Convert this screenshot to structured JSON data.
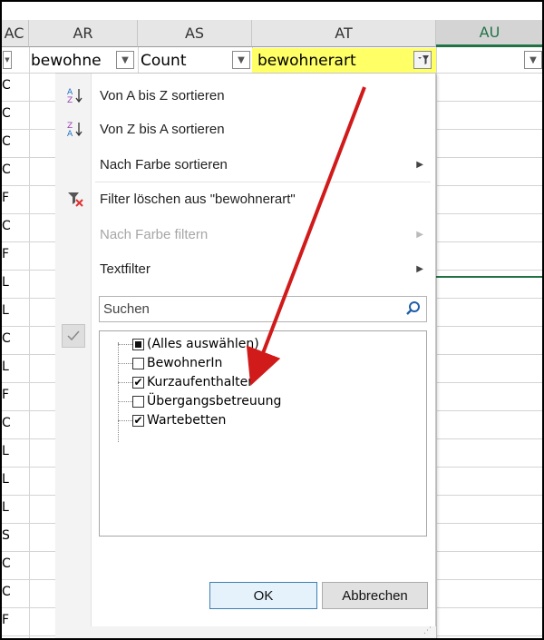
{
  "columns": {
    "ac": "AC",
    "ar": "AR",
    "as": "AS",
    "at": "AT",
    "au": "AU"
  },
  "header_row": {
    "ar_value": "bewohne",
    "as_value": "Count",
    "at_value": "bewohnerart"
  },
  "left_column_cells": [
    "C",
    "C",
    "C",
    "C",
    "F",
    "C",
    "F",
    "L",
    "L",
    "C",
    "L",
    "F",
    "C",
    "L",
    "L",
    "L",
    "S",
    "C",
    "C",
    "F"
  ],
  "menu": {
    "items": [
      {
        "label": "Von A bis Z sortieren",
        "icon": "sort-az-icon"
      },
      {
        "label": "Von Z bis A sortieren",
        "icon": "sort-za-icon"
      },
      {
        "label": "Nach Farbe sortieren",
        "icon": ""
      },
      {
        "label": "Filter löschen aus \"bewohnerart\"",
        "icon": "clear-filter-icon"
      },
      {
        "label": "Nach Farbe filtern",
        "icon": ""
      },
      {
        "label": "Textfilter",
        "icon": ""
      }
    ],
    "search_placeholder": "Suchen",
    "list": [
      {
        "label": "(Alles auswählen)",
        "state": "partial"
      },
      {
        "label": "BewohnerIn",
        "state": "unchecked"
      },
      {
        "label": "Kurzaufenthalter",
        "state": "checked"
      },
      {
        "label": "Übergangsbetreuung",
        "state": "unchecked"
      },
      {
        "label": "Wartebetten",
        "state": "checked"
      }
    ],
    "ok_label": "OK",
    "cancel_label": "Abbrechen"
  },
  "colors": {
    "header_highlight": "#ffff66",
    "accent_green": "#217346",
    "arrow": "#d11a1a"
  }
}
